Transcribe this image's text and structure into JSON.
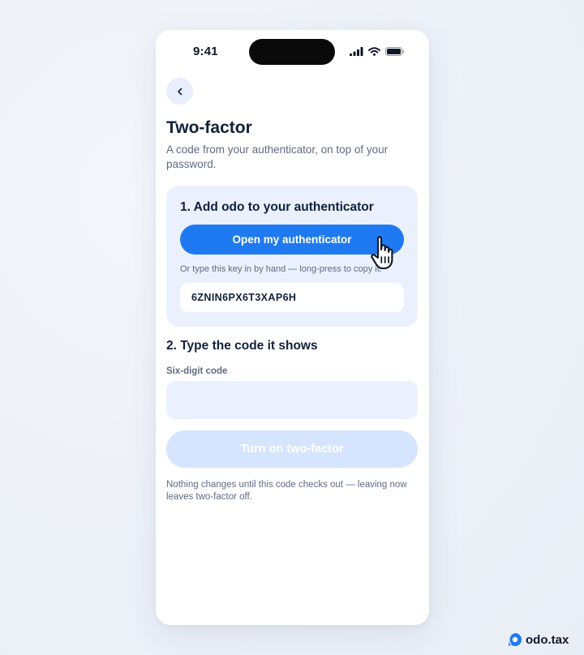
{
  "status_bar": {
    "time": "9:41"
  },
  "nav": {
    "back_icon": "chevron-left-icon"
  },
  "header": {
    "title": "Two-factor",
    "subtitle": "A code from your authenticator, on top of your password."
  },
  "step1": {
    "heading": "1. Add odo to your authenticator",
    "open_button_label": "Open my authenticator",
    "hint": "Or type this key in by hand — long-press to copy it.",
    "secret_key": "6ZNIN6PX6T3XAP6H"
  },
  "step2": {
    "heading": "2. Type the code it shows",
    "code_label": "Six-digit code",
    "code_value": "",
    "submit_label": "Turn on two-factor",
    "footnote": "Nothing changes until this code checks out — leaving now leaves two-factor off."
  },
  "brand": {
    "name": "odo.tax"
  },
  "colors": {
    "accent": "#1f7af2",
    "disabled": "#d4e5fd",
    "card_bg": "#eaf1fd",
    "text_primary": "#12203a",
    "text_secondary": "#5f6b80"
  }
}
